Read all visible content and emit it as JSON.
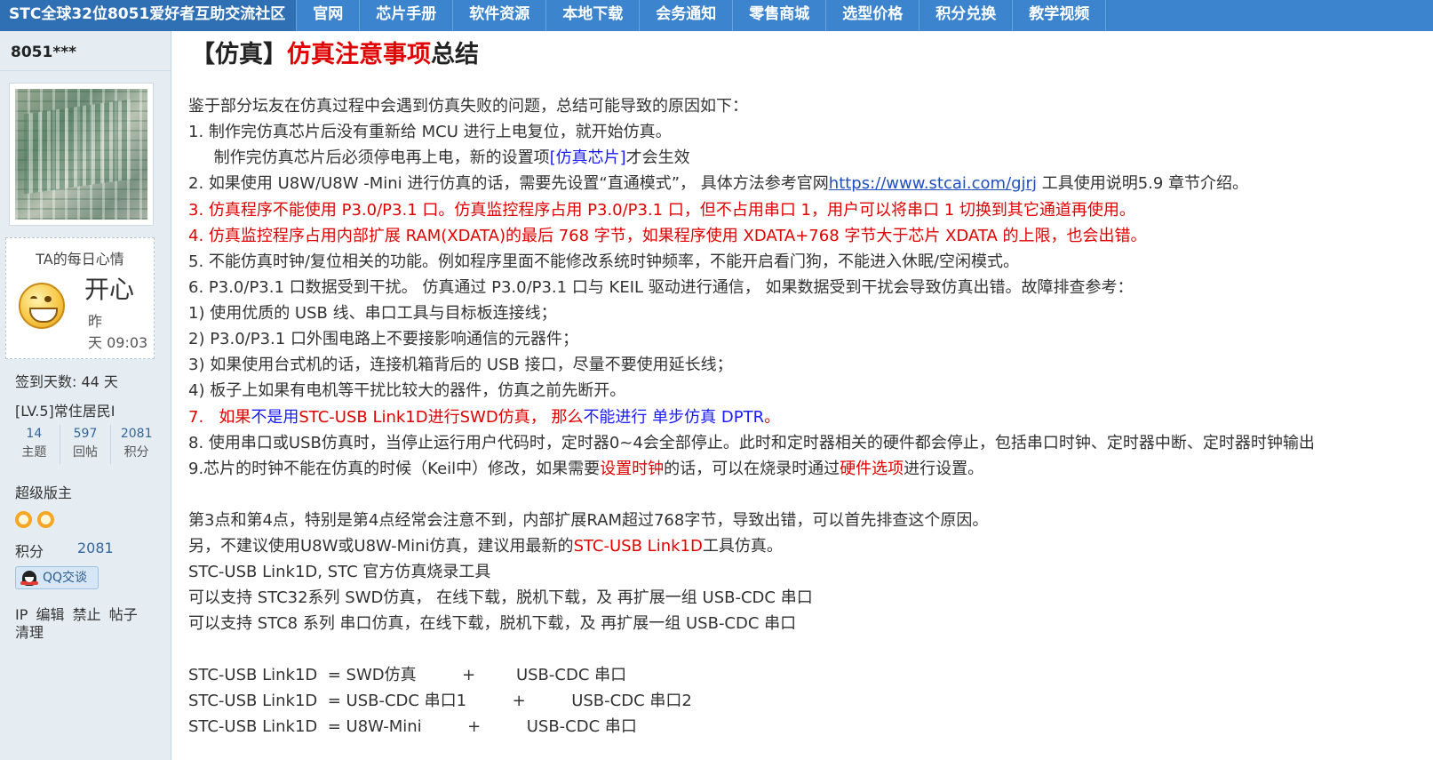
{
  "nav": {
    "brand": "STC全球32位8051爱好者互助交流社区",
    "items": [
      "官网",
      "芯片手册",
      "软件资源",
      "本地下载",
      "会务通知",
      "零售商城",
      "选型价格",
      "积分兑换",
      "教学视频"
    ]
  },
  "sidebar": {
    "username": "8051***",
    "mood": {
      "title": "TA的每日心情",
      "text": "开心",
      "time_line1": "昨",
      "time_line2": "天 09:03"
    },
    "checkin": "签到天数: 44 天",
    "level": "[LV.5]常住居民I",
    "stats": [
      {
        "num": "14",
        "label": "主题"
      },
      {
        "num": "597",
        "label": "回帖"
      },
      {
        "num": "2081",
        "label": "积分"
      }
    ],
    "role": "超级版主",
    "score_label": "积分",
    "score_value": "2081",
    "qq_label": "QQ交谈",
    "admin": [
      "IP",
      "编辑",
      "禁止",
      "帖子",
      "清理"
    ]
  },
  "post": {
    "title": {
      "bracket": "【仿真】",
      "red": "仿真注意事项",
      "tail": "总结"
    },
    "lines": {
      "l0": "鉴于部分坛友在仿真过程中会遇到仿真失败的问题，总结可能导致的原因如下：",
      "l1": "1.  制作完仿真芯片后没有重新给 MCU 进行上电复位，就开始仿真。",
      "l2a": "     制作完仿真芯片后必须停电再上电，新的设置项",
      "l2b": "[仿真芯片]",
      "l2c": "才会生效",
      "l3a": "2.  如果使用 U8W/U8W -Mini 进行仿真的话，需要先设置“直通模式”， 具体方法参考官网",
      "l3b": "https://www.stcai.com/gjrj",
      "l3c": " 工具使用说明5.9 章节介绍。",
      "l4": "3.  仿真程序不能使用 P3.0/P3.1 口。仿真监控程序占用 P3.0/P3.1 口，但不占用串口 1，用户可以将串口 1 切换到其它通道再使用。",
      "l5": "4.  仿真监控程序占用内部扩展 RAM(XDATA)的最后 768 字节，如果程序使用 XDATA+768 字节大于芯片 XDATA 的上限，也会出错。",
      "l6": "5.  不能仿真时钟/复位相关的功能。例如程序里面不能修改系统时钟频率，不能开启看门狗，不能进入休眠/空闲模式。",
      "l7": "6.  P3.0/P3.1 口数据受到干扰。 仿真通过 P3.0/P3.1 口与 KEIL 驱动进行通信， 如果数据受到干扰会导致仿真出错。故障排查参考：",
      "l8": "1)  使用优质的 USB 线、串口工具与目标板连接线；",
      "l9": "2)  P3.0/P3.1 口外围电路上不要接影响通信的元器件；",
      "l10": "3)  如果使用台式机的话，连接机箱背后的 USB 接口，尽量不要使用延长线；",
      "l11": "4)  板子上如果有电机等干扰比较大的器件，仿真之前先断开。",
      "l12a": "7.   如果",
      "l12b": "不是用",
      "l12c": "STC-USB Link1D进行SWD仿真， 那么",
      "l12d": "不能进行 单步仿真 DPTR",
      "l12e": "。",
      "l13": "8. 使用串口或USB仿真时，当停止运行用户代码时，定时器0~4会全部停止。此时和定时器相关的硬件都会停止，包括串口时钟、定时器中断、定时器时钟输出",
      "l14a": "9.芯片的时钟不能在仿真的时候（Keil中）修改，如果需要",
      "l14b": "设置时钟",
      "l14c": "的话，可以在烧录时通过",
      "l14d": "硬件选项",
      "l14e": "进行设置。",
      "l15": "第3点和第4点，特别是第4点经常会注意不到，内部扩展RAM超过768字节，导致出错，可以首先排查这个原因。",
      "l16a": "另，不建议使用U8W或U8W-Mini仿真，建议用最新的",
      "l16b": "STC-USB Link1D",
      "l16c": "工具仿真。",
      "l17": "STC-USB Link1D, STC 官方仿真烧录工具",
      "l18": "可以支持 STC32系列 SWD仿真， 在线下载，脱机下载，及 再扩展一组 USB-CDC 串口",
      "l19": "可以支持 STC8 系列 串口仿真，在线下载，脱机下载，及 再扩展一组 USB-CDC 串口",
      "l20": "STC-USB Link1D  = SWD仿真         +        USB-CDC 串口",
      "l21": "STC-USB Link1D  = USB-CDC 串口1         +         USB-CDC 串口2",
      "l22": "STC-USB Link1D  = U8W-Mini         +         USB-CDC 串口"
    }
  },
  "colors": {
    "nav_bg": "#3c84ce",
    "sidebar_bg": "#e5edf2",
    "emphasis_red": "#e00000",
    "emphasis_blue": "#1a1aff",
    "link": "#1f4fbf"
  }
}
